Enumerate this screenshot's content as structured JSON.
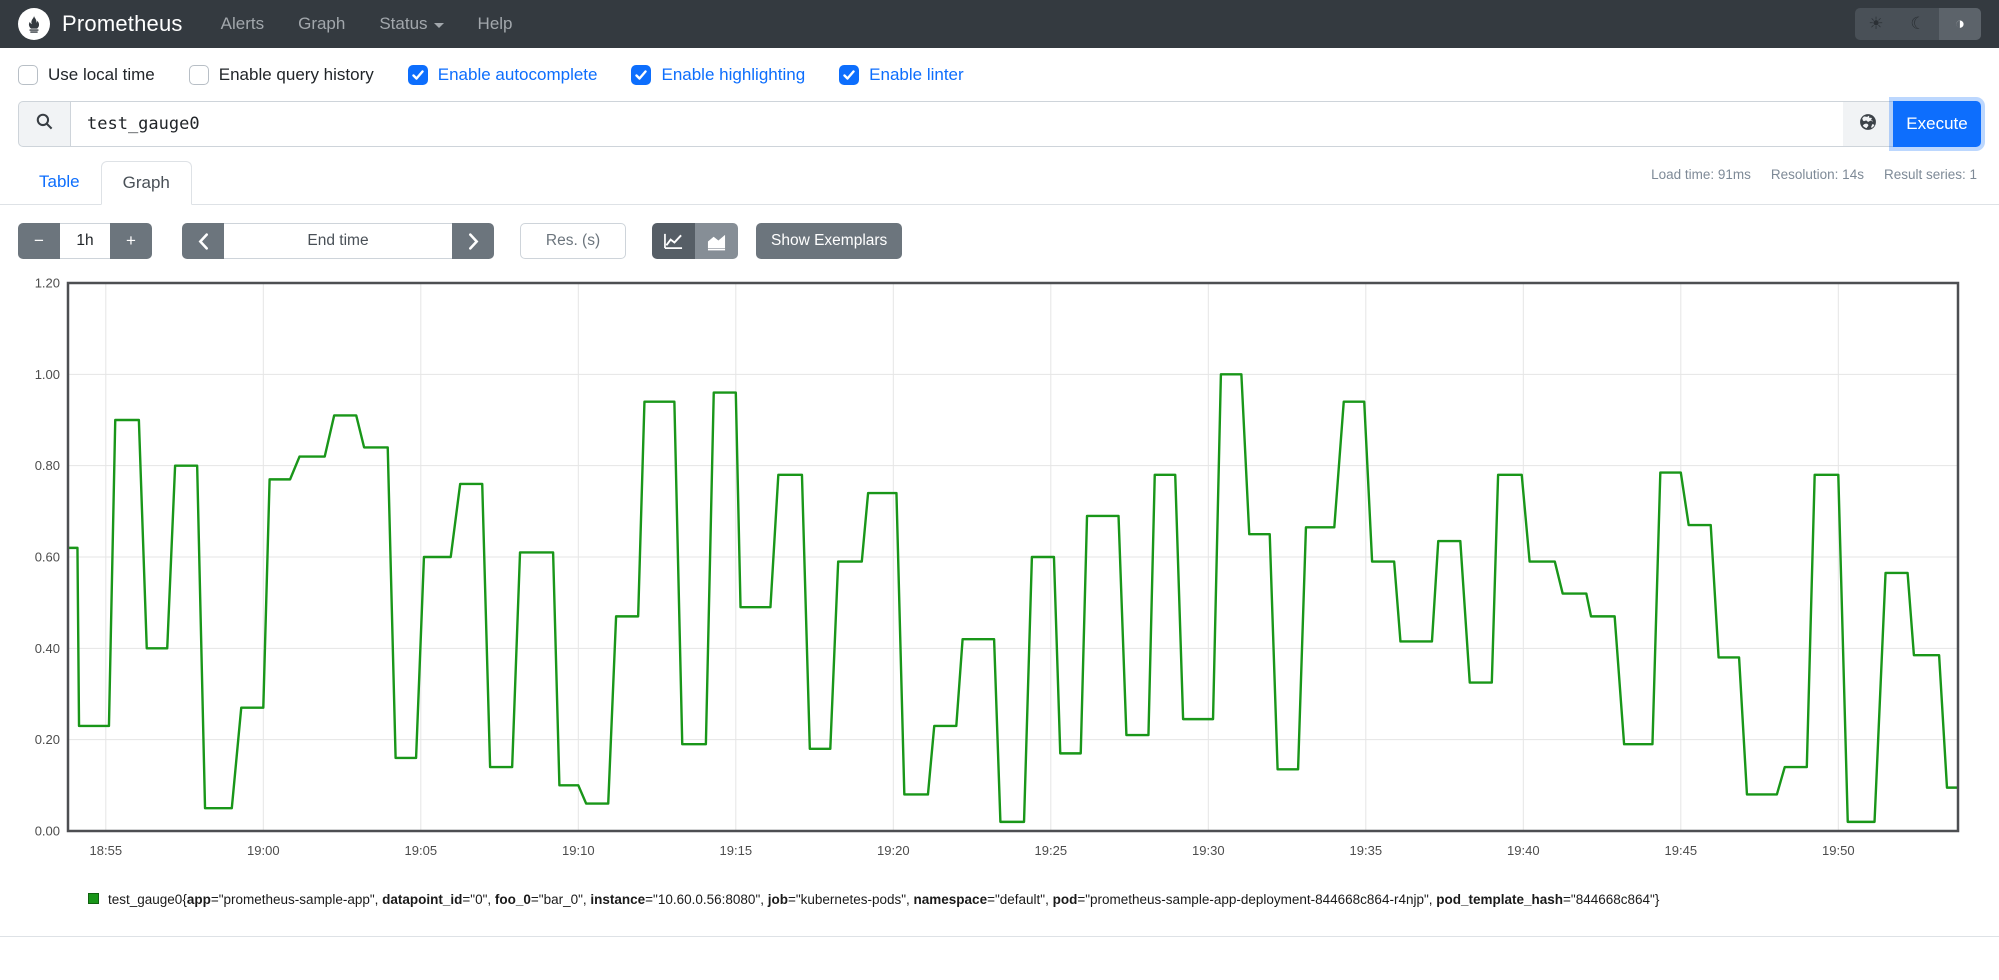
{
  "navbar": {
    "brand": "Prometheus",
    "items": [
      {
        "label": "Alerts",
        "caret": false
      },
      {
        "label": "Graph",
        "caret": false
      },
      {
        "label": "Status",
        "caret": true
      },
      {
        "label": "Help",
        "caret": false
      }
    ],
    "theme_buttons": [
      {
        "icon": "sun-icon",
        "glyph": "☀",
        "active": false
      },
      {
        "icon": "moon-icon",
        "glyph": "☾",
        "active": false
      },
      {
        "icon": "auto-contrast-icon",
        "glyph": "◑",
        "active": true
      }
    ]
  },
  "options": {
    "checkboxes": [
      {
        "label": "Use local time",
        "checked": false
      },
      {
        "label": "Enable query history",
        "checked": false
      },
      {
        "label": "Enable autocomplete",
        "checked": true
      },
      {
        "label": "Enable highlighting",
        "checked": true
      },
      {
        "label": "Enable linter",
        "checked": true
      }
    ]
  },
  "query": {
    "value": "test_gauge0",
    "execute_label": "Execute"
  },
  "tabs": [
    {
      "label": "Table",
      "active": false
    },
    {
      "label": "Graph",
      "active": true
    }
  ],
  "stats": [
    "Load time: 91ms",
    "Resolution: 14s",
    "Result series: 1"
  ],
  "graph_controls": {
    "minus_label": "−",
    "duration": "1h",
    "plus_label": "+",
    "prev_label": "❮",
    "end_time_placeholder": "End time",
    "next_label": "❯",
    "res_placeholder": "Res. (s)",
    "show_exemplars_label": "Show Exemplars"
  },
  "legend": {
    "metric": "test_gauge0",
    "labels": [
      {
        "name": "app",
        "value": "prometheus-sample-app"
      },
      {
        "name": "datapoint_id",
        "value": "0"
      },
      {
        "name": "foo_0",
        "value": "bar_0"
      },
      {
        "name": "instance",
        "value": "10.60.0.56:8080"
      },
      {
        "name": "job",
        "value": "kubernetes-pods"
      },
      {
        "name": "namespace",
        "value": "default"
      },
      {
        "name": "pod",
        "value": "prometheus-sample-app-deployment-844668c864-r4njp"
      },
      {
        "name": "pod_template_hash",
        "value": "844668c864"
      }
    ],
    "swatch_color": "#199619"
  },
  "chart_data": {
    "type": "line",
    "title": "",
    "xlabel": "",
    "ylabel": "",
    "line_color": "#199619",
    "grid_color": "#e5e5e5",
    "border_color": "#4d4f52",
    "tick_color": "#4d4d4d",
    "ylim": [
      0,
      1.2
    ],
    "y_ticks": [
      0,
      0.2,
      0.4,
      0.6,
      0.8,
      1.0,
      1.2
    ],
    "y_tick_labels": [
      "0.00",
      "0.20",
      "0.40",
      "0.60",
      "0.80",
      "1.00",
      "1.20"
    ],
    "x_domain_minutes": [
      -1.2,
      58.8
    ],
    "x_ticks_minutes": [
      0,
      5,
      10,
      15,
      20,
      25,
      30,
      35,
      40,
      45,
      50,
      55
    ],
    "x_tick_labels": [
      "18:55",
      "19:00",
      "19:05",
      "19:10",
      "19:15",
      "19:20",
      "19:25",
      "19:30",
      "19:35",
      "19:40",
      "19:45",
      "19:50"
    ],
    "series_name": "test_gauge0",
    "segments": [
      [
        -1.2,
        -0.9,
        0.62
      ],
      [
        -0.85,
        0.1,
        0.23
      ],
      [
        0.3,
        1.05,
        0.9
      ],
      [
        1.3,
        1.95,
        0.4
      ],
      [
        2.2,
        2.9,
        0.8
      ],
      [
        3.15,
        4.0,
        0.05
      ],
      [
        4.3,
        5.0,
        0.27
      ],
      [
        5.2,
        5.85,
        0.77
      ],
      [
        6.15,
        6.95,
        0.82
      ],
      [
        7.25,
        7.95,
        0.91
      ],
      [
        8.2,
        8.95,
        0.84
      ],
      [
        9.2,
        9.85,
        0.16
      ],
      [
        10.1,
        10.95,
        0.6
      ],
      [
        11.25,
        11.95,
        0.76
      ],
      [
        12.2,
        12.9,
        0.14
      ],
      [
        13.15,
        14.2,
        0.61
      ],
      [
        14.4,
        15.0,
        0.1
      ],
      [
        15.25,
        15.95,
        0.06
      ],
      [
        16.2,
        16.9,
        0.47
      ],
      [
        17.1,
        18.05,
        0.94
      ],
      [
        18.3,
        19.05,
        0.19
      ],
      [
        19.3,
        20.0,
        0.96
      ],
      [
        20.15,
        21.1,
        0.49
      ],
      [
        21.35,
        22.1,
        0.78
      ],
      [
        22.35,
        23.0,
        0.18
      ],
      [
        23.25,
        24.0,
        0.59
      ],
      [
        24.2,
        25.1,
        0.74
      ],
      [
        25.35,
        26.1,
        0.08
      ],
      [
        26.3,
        27.0,
        0.23
      ],
      [
        27.2,
        28.2,
        0.42
      ],
      [
        28.4,
        29.15,
        0.02
      ],
      [
        29.4,
        30.1,
        0.6
      ],
      [
        30.3,
        30.95,
        0.17
      ],
      [
        31.15,
        32.15,
        0.69
      ],
      [
        32.4,
        33.1,
        0.21
      ],
      [
        33.3,
        33.95,
        0.78
      ],
      [
        34.2,
        35.15,
        0.245
      ],
      [
        35.4,
        36.05,
        1.0
      ],
      [
        36.3,
        36.95,
        0.65
      ],
      [
        37.2,
        37.85,
        0.135
      ],
      [
        38.1,
        39.0,
        0.665
      ],
      [
        39.3,
        39.95,
        0.94
      ],
      [
        40.2,
        40.9,
        0.59
      ],
      [
        41.1,
        42.1,
        0.415
      ],
      [
        42.3,
        43.0,
        0.635
      ],
      [
        43.3,
        44.0,
        0.325
      ],
      [
        44.2,
        44.95,
        0.78
      ],
      [
        45.2,
        46.0,
        0.59
      ],
      [
        46.25,
        47.0,
        0.52
      ],
      [
        47.15,
        47.9,
        0.47
      ],
      [
        48.2,
        49.1,
        0.19
      ],
      [
        49.35,
        50.0,
        0.785
      ],
      [
        50.25,
        50.95,
        0.67
      ],
      [
        51.2,
        51.85,
        0.38
      ],
      [
        52.1,
        53.05,
        0.08
      ],
      [
        53.3,
        54.0,
        0.14
      ],
      [
        54.25,
        55.0,
        0.78
      ],
      [
        55.3,
        56.15,
        0.02
      ],
      [
        56.5,
        57.2,
        0.565
      ],
      [
        57.4,
        58.2,
        0.385
      ],
      [
        58.45,
        58.8,
        0.095
      ]
    ]
  }
}
